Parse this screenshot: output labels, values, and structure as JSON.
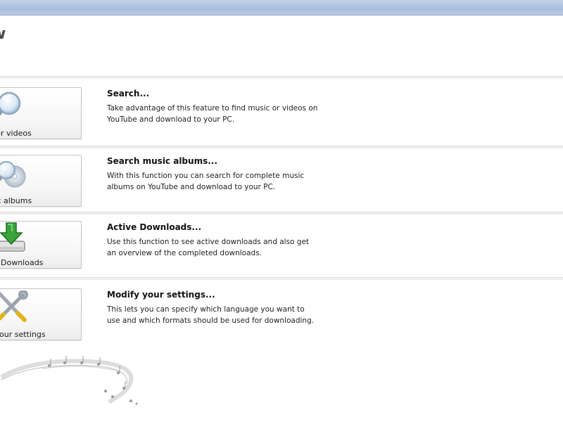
{
  "window": {
    "title_fragment": "w"
  },
  "items": [
    {
      "tile_label": "usic or videos",
      "title": "Search...",
      "description": "Take advantage of this feature to find music or videos on YouTube and download to your PC.",
      "icon": "magnifier-icon"
    },
    {
      "tile_label": "music albums",
      "title": "Search music albums...",
      "description": "With this function you can search for complete music albums on YouTube and download to your PC.",
      "icon": "cd-magnifier-icon"
    },
    {
      "tile_label": "Downloads",
      "title": "Active Downloads...",
      "description": "Use this function to see active downloads and also get an overview of the completed downloads.",
      "icon": "download-arrow-icon"
    },
    {
      "tile_label": "our settings",
      "title": "Modify your settings...",
      "description": "This lets you can specify which language you want to use and which formats should be used for downloading.",
      "icon": "tools-icon"
    }
  ],
  "colors": {
    "window_frame": "#aabfdc",
    "title_text": "#4a4a4a",
    "download_green": "#3aa43a"
  }
}
